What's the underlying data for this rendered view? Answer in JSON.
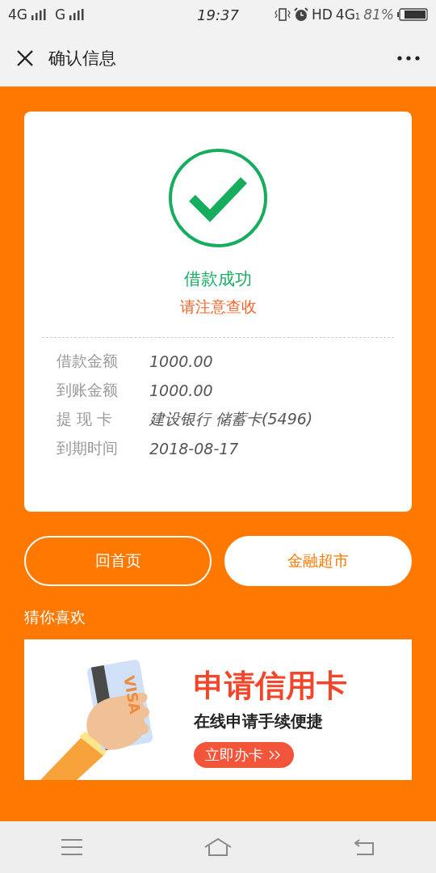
{
  "status_bar": {
    "signal_1": "4G",
    "signal_2": "G",
    "time": "19:37",
    "hd": "HD",
    "network": "4G",
    "sim": "1",
    "battery": "81%"
  },
  "header": {
    "title": "确认信息"
  },
  "result": {
    "title": "借款成功",
    "subtitle": "请注意查收"
  },
  "details": [
    {
      "label": "借款金额",
      "value": "1000.00"
    },
    {
      "label": "到账金额",
      "value": "1000.00"
    },
    {
      "label": "提 现 卡",
      "value": "建设银行 储蓄卡(5496)"
    },
    {
      "label": "到期时间",
      "value": "2018-08-17"
    }
  ],
  "buttons": [
    {
      "label": "回首页",
      "kind": "outline"
    },
    {
      "label": "金融超市",
      "kind": "filled"
    }
  ],
  "recommend": {
    "heading": "猜你喜欢",
    "banner": {
      "title": "申请信用卡",
      "subtitle": "在线申请手续便捷",
      "button": "立即办卡",
      "card_brand": "VISA"
    }
  }
}
